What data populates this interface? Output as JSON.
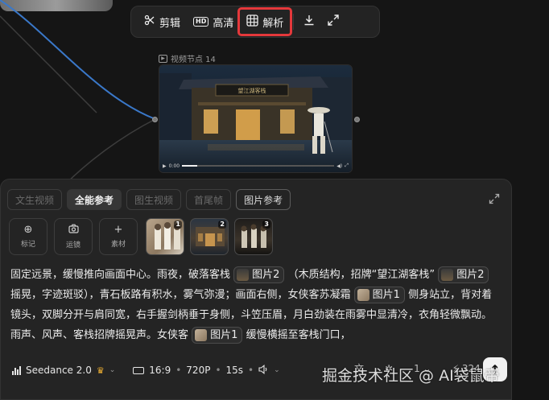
{
  "toolbar": {
    "items": [
      {
        "label": "剪辑",
        "icon": "scissors-icon"
      },
      {
        "label": "高清",
        "icon": "hd-icon",
        "badge": "HD"
      },
      {
        "label": "解析",
        "icon": "grid-icon",
        "highlighted": true
      }
    ],
    "download_icon": "download-icon",
    "fullscreen_icon": "expand-icon",
    "highlight_color": "#e5383b"
  },
  "video_node": {
    "label": "视频节点 14",
    "signboard": "望江湖客栈",
    "time": "0:00",
    "progress": 0.1
  },
  "panel": {
    "mode_tabs": [
      {
        "label": "文生视频",
        "state": "disabled"
      },
      {
        "label": "全能参考",
        "state": "active"
      },
      {
        "label": "图生视频",
        "state": "disabled"
      },
      {
        "label": "首尾帧",
        "state": "disabled"
      },
      {
        "label": "图片参考",
        "state": "outlined"
      }
    ],
    "tools": [
      {
        "label": "标记",
        "icon": "mark-icon"
      },
      {
        "label": "运镜",
        "icon": "camera-icon"
      },
      {
        "label": "素材",
        "icon": "plus-icon"
      }
    ],
    "thumbnails": [
      "1",
      "2",
      "3"
    ],
    "prompt": {
      "seg1": "固定远景，缓慢推向画面中心。雨夜，破落客栈",
      "chip1": "图片2",
      "seg2": "（木质结构，招牌“望江湖客栈”",
      "chip2": "图片2",
      "seg3": "摇晃，字迹斑驳），青石板路有积水，雾气弥漫；画面右侧，女侠客苏凝霜",
      "chip3": "图片1",
      "seg4": "侧身站立，背对着镜头，双脚分开与肩同宽，右手握剑柄垂于身侧，斗笠压眉，月白劲装在雨雾中显清冷，衣角轻微飘动。雨声、风声、客栈招牌摇晃声。女侠客",
      "chip4": "图片1",
      "seg5": "缓慢横摇至客栈门口，"
    },
    "footer": {
      "model": "Seedance 2.0",
      "ratio": "16:9",
      "resolution": "720P",
      "duration": "15s",
      "audio_icon": "speaker-icon",
      "count": "1",
      "credits": "324"
    }
  },
  "watermark": "掘金技术社区 @ AI袋鼠帝"
}
